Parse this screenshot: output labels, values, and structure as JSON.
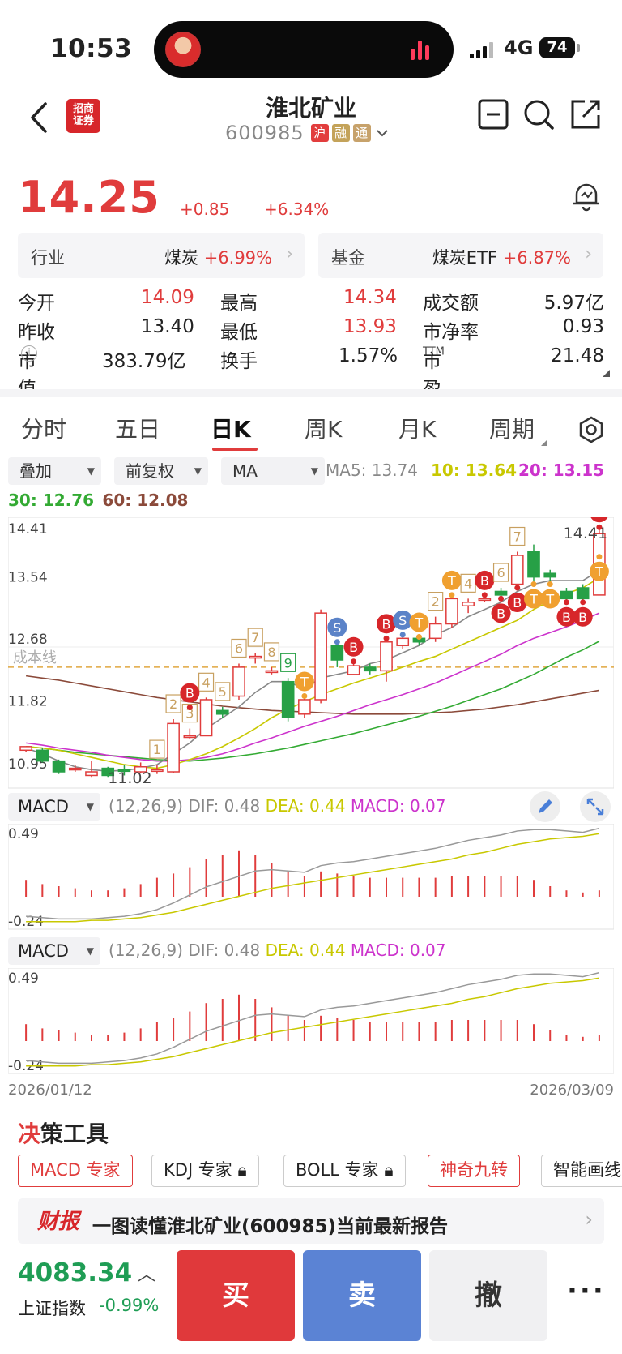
{
  "status_bar": {
    "time": "10:53",
    "network": "4G",
    "battery": "74"
  },
  "header": {
    "logo_text": "招商\n证券",
    "stock_name": "淮北矿业",
    "stock_code": "600985",
    "tags": [
      "沪",
      "融",
      "通"
    ]
  },
  "quote": {
    "price": "14.25",
    "change": "+0.85",
    "change_pct": "+6.34%"
  },
  "sector": {
    "industry_label": "行业",
    "industry_name": "煤炭",
    "industry_chg": "+6.99%",
    "fund_label": "基金",
    "fund_name": "煤炭ETF",
    "fund_chg": "+6.87%"
  },
  "stats": {
    "open_label": "今开",
    "open": "14.09",
    "high_label": "最高",
    "high": "14.34",
    "turnover_amt_label": "成交额",
    "turnover_amt": "5.97亿",
    "prev_close_label": "昨收",
    "prev_close": "13.40",
    "low_label": "最低",
    "low": "13.93",
    "pb_label": "市净率",
    "pb": "0.93",
    "mcap_label": "市值",
    "mcap": "383.79亿",
    "turnover_label": "换手",
    "turnover": "1.57%",
    "pe_label": "市盈",
    "pe_sup": "TTM",
    "pe": "21.48"
  },
  "tabs": [
    "分时",
    "五日",
    "日K",
    "周K",
    "月K",
    "周期"
  ],
  "active_tab": "日K",
  "controls": {
    "overlay": "叠加",
    "adjust": "前复权",
    "indicator": "MA",
    "ma5": "MA5: 13.74",
    "ma10": "10: 13.64",
    "ma20": "20: 13.15",
    "ma30": "30: 12.76",
    "ma60": "60: 12.08"
  },
  "colors": {
    "up": "#e03c3c",
    "down": "#27a046",
    "ma5": "#888888",
    "ma10": "#c8c800",
    "ma20": "#cc33cc",
    "ma30": "#33aa33",
    "ma60": "#8b4a3a",
    "cost_line": "#e0a840",
    "buy_marker": "#d7262a",
    "sell_marker": "#5b83c8",
    "t_marker": "#f0a030"
  },
  "chart_data": [
    {
      "type": "candlestick",
      "y_ticks": [
        "14.41",
        "13.54",
        "12.68",
        "11.82",
        "10.95"
      ],
      "ylim": [
        10.95,
        14.41
      ],
      "cost_line_label": "成本线",
      "cost_line_value": 12.4,
      "low_label": "11.02",
      "high_label": "14.41",
      "candles": [
        [
          11.25,
          11.3,
          11.3,
          11.22
        ],
        [
          11.25,
          11.1,
          11.28,
          11.08
        ],
        [
          11.1,
          10.95,
          11.12,
          10.92
        ],
        [
          11.0,
          11.0,
          11.05,
          10.95
        ],
        [
          10.9,
          10.95,
          11.1,
          10.88
        ],
        [
          11.0,
          10.9,
          11.02,
          10.88
        ],
        [
          10.98,
          10.97,
          11.05,
          10.9
        ],
        [
          10.95,
          11.02,
          11.08,
          10.93
        ],
        [
          10.98,
          10.98,
          11.05,
          10.92
        ],
        [
          10.95,
          11.62,
          11.68,
          10.93
        ],
        [
          11.45,
          11.45,
          11.55,
          11.4
        ],
        [
          11.45,
          11.95,
          11.98,
          11.45
        ],
        [
          11.8,
          11.75,
          11.85,
          11.7
        ],
        [
          12.0,
          12.4,
          12.45,
          11.95
        ],
        [
          12.55,
          12.55,
          12.6,
          12.45
        ],
        [
          12.35,
          12.35,
          12.4,
          12.3
        ],
        [
          12.2,
          11.7,
          12.25,
          11.65
        ],
        [
          11.75,
          11.95,
          12.0,
          11.7
        ],
        [
          11.95,
          13.15,
          13.2,
          11.9
        ],
        [
          12.7,
          12.5,
          12.75,
          12.4
        ],
        [
          12.3,
          12.42,
          12.48,
          12.3
        ],
        [
          12.4,
          12.35,
          12.45,
          12.3
        ],
        [
          12.35,
          12.75,
          12.8,
          12.2
        ],
        [
          12.7,
          12.8,
          12.85,
          12.65
        ],
        [
          12.8,
          12.75,
          12.82,
          12.7
        ],
        [
          12.8,
          13.0,
          13.1,
          12.75
        ],
        [
          13.0,
          13.35,
          13.4,
          12.95
        ],
        [
          13.25,
          13.3,
          13.35,
          13.15
        ],
        [
          13.35,
          13.35,
          13.4,
          13.3
        ],
        [
          13.45,
          13.4,
          13.5,
          13.35
        ],
        [
          13.55,
          13.95,
          14.0,
          13.5
        ],
        [
          14.0,
          13.65,
          14.1,
          13.55
        ],
        [
          13.7,
          13.65,
          13.75,
          13.55
        ],
        [
          13.45,
          13.35,
          13.5,
          13.3
        ],
        [
          13.5,
          13.35,
          13.55,
          13.3
        ],
        [
          13.4,
          14.25,
          14.34,
          13.93
        ]
      ],
      "ma5": [
        11.28,
        11.2,
        11.1,
        11.02,
        10.98,
        10.96,
        10.97,
        11.0,
        11.05,
        11.2,
        11.35,
        11.55,
        11.7,
        11.85,
        12.05,
        12.2,
        12.2,
        12.1,
        12.25,
        12.3,
        12.35,
        12.45,
        12.5,
        12.6,
        12.7,
        12.85,
        12.95,
        13.1,
        13.2,
        13.3,
        13.45,
        13.55,
        13.6,
        13.6,
        13.6,
        13.74
      ],
      "ma10": [
        11.3,
        11.28,
        11.25,
        11.2,
        11.15,
        11.1,
        11.05,
        11.02,
        11.0,
        11.05,
        11.12,
        11.2,
        11.3,
        11.42,
        11.55,
        11.7,
        11.82,
        11.92,
        12.02,
        12.1,
        12.18,
        12.25,
        12.32,
        12.4,
        12.48,
        12.55,
        12.65,
        12.75,
        12.85,
        12.95,
        13.05,
        13.2,
        13.32,
        13.42,
        13.5,
        13.64
      ],
      "ma20": [
        11.35,
        11.32,
        11.28,
        11.25,
        11.22,
        11.18,
        11.15,
        11.12,
        11.1,
        11.1,
        11.12,
        11.15,
        11.2,
        11.27,
        11.35,
        11.42,
        11.5,
        11.58,
        11.65,
        11.72,
        11.8,
        11.88,
        11.95,
        12.02,
        12.1,
        12.18,
        12.28,
        12.38,
        12.48,
        12.58,
        12.7,
        12.8,
        12.88,
        12.96,
        13.05,
        13.15
      ],
      "ma30": [
        11.3,
        11.28,
        11.25,
        11.22,
        11.2,
        11.18,
        11.16,
        11.14,
        11.12,
        11.11,
        11.1,
        11.12,
        11.14,
        11.17,
        11.2,
        11.24,
        11.28,
        11.33,
        11.38,
        11.43,
        11.48,
        11.54,
        11.6,
        11.66,
        11.72,
        11.79,
        11.86,
        11.94,
        12.02,
        12.1,
        12.2,
        12.3,
        12.42,
        12.54,
        12.64,
        12.76
      ],
      "ma60": [
        12.28,
        12.25,
        12.22,
        12.18,
        12.14,
        12.1,
        12.06,
        12.02,
        11.98,
        11.95,
        11.92,
        11.89,
        11.86,
        11.84,
        11.82,
        11.8,
        11.79,
        11.78,
        11.77,
        11.76,
        11.75,
        11.75,
        11.75,
        11.75,
        11.76,
        11.77,
        11.78,
        11.8,
        11.82,
        11.85,
        11.88,
        11.92,
        11.96,
        12.0,
        12.04,
        12.08
      ],
      "markers": [
        {
          "i": 8,
          "label": "1",
          "kind": "nine"
        },
        {
          "i": 9,
          "label": "2",
          "kind": "nine"
        },
        {
          "i": 10,
          "label": "3",
          "kind": "nine"
        },
        {
          "i": 11,
          "label": "4",
          "kind": "nine"
        },
        {
          "i": 12,
          "label": "5",
          "kind": "nine"
        },
        {
          "i": 13,
          "label": "6",
          "kind": "nine"
        },
        {
          "i": 14,
          "label": "7",
          "kind": "nine"
        },
        {
          "i": 15,
          "label": "8",
          "kind": "nine"
        },
        {
          "i": 16,
          "label": "9",
          "kind": "nine-green"
        },
        {
          "i": 10,
          "label": "B",
          "kind": "buy"
        },
        {
          "i": 17,
          "label": "T",
          "kind": "t"
        },
        {
          "i": 19,
          "label": "S",
          "kind": "sell"
        },
        {
          "i": 20,
          "label": "B",
          "kind": "buy"
        },
        {
          "i": 22,
          "label": "B",
          "kind": "buy"
        },
        {
          "i": 23,
          "label": "S",
          "kind": "sell"
        },
        {
          "i": 24,
          "label": "T",
          "kind": "t"
        },
        {
          "i": 25,
          "label": "2",
          "kind": "nine"
        },
        {
          "i": 26,
          "label": "T",
          "kind": "t"
        },
        {
          "i": 27,
          "label": "4",
          "kind": "nine"
        },
        {
          "i": 28,
          "label": "B",
          "kind": "buy"
        },
        {
          "i": 29,
          "label": "6",
          "kind": "nine"
        },
        {
          "i": 30,
          "label": "7",
          "kind": "nine"
        },
        {
          "i": 29,
          "label": "B",
          "kind": "buy-low"
        },
        {
          "i": 30,
          "label": "B",
          "kind": "buy-low"
        },
        {
          "i": 31,
          "label": "T",
          "kind": "t-low"
        },
        {
          "i": 32,
          "label": "T",
          "kind": "t-low"
        },
        {
          "i": 33,
          "label": "B",
          "kind": "buy-low"
        },
        {
          "i": 34,
          "label": "B",
          "kind": "buy-low"
        },
        {
          "i": 35,
          "label": "B",
          "kind": "buy"
        },
        {
          "i": 35,
          "label": "T",
          "kind": "t-low"
        }
      ]
    },
    {
      "type": "macd",
      "title": "MACD",
      "params": "(12,26,9)",
      "dif": "DIF: 0.48",
      "dea": "DEA: 0.44",
      "macd": "MACD: 0.07",
      "y_ticks": [
        "0.49",
        "-0.24"
      ],
      "ylim": [
        -0.24,
        0.49
      ],
      "hist": [
        0.08,
        0.06,
        0.05,
        0.04,
        0.03,
        0.03,
        0.04,
        0.06,
        0.09,
        0.11,
        0.14,
        0.18,
        0.2,
        0.22,
        0.2,
        0.16,
        0.12,
        0.1,
        0.12,
        0.11,
        0.1,
        0.09,
        0.09,
        0.09,
        0.09,
        0.09,
        0.1,
        0.1,
        0.1,
        0.1,
        0.1,
        0.08,
        0.05,
        0.03,
        0.02,
        0.03
      ],
      "dif_line": [
        -0.18,
        -0.19,
        -0.2,
        -0.2,
        -0.2,
        -0.19,
        -0.18,
        -0.16,
        -0.13,
        -0.08,
        -0.02,
        0.04,
        0.08,
        0.12,
        0.16,
        0.17,
        0.16,
        0.15,
        0.2,
        0.22,
        0.23,
        0.25,
        0.27,
        0.29,
        0.31,
        0.33,
        0.36,
        0.39,
        0.41,
        0.43,
        0.46,
        0.47,
        0.47,
        0.46,
        0.45,
        0.48
      ],
      "dea_line": [
        -0.22,
        -0.22,
        -0.22,
        -0.22,
        -0.21,
        -0.21,
        -0.2,
        -0.19,
        -0.17,
        -0.15,
        -0.12,
        -0.09,
        -0.06,
        -0.03,
        0.0,
        0.03,
        0.05,
        0.07,
        0.09,
        0.11,
        0.13,
        0.15,
        0.17,
        0.19,
        0.21,
        0.23,
        0.25,
        0.28,
        0.3,
        0.33,
        0.36,
        0.38,
        0.4,
        0.41,
        0.42,
        0.44
      ]
    }
  ],
  "date_range": {
    "start": "2026/01/12",
    "end": "2026/03/09"
  },
  "tools": {
    "title_first": "决",
    "title_rest": "策工具",
    "chips": [
      "MACD 专家",
      "KDJ 专家",
      "BOLL 专家",
      "神奇九转",
      "智能画线"
    ]
  },
  "report": {
    "logo": "财报",
    "text": "一图读懂淮北矿业(600985)当前最新报告"
  },
  "bottom": {
    "index_value": "4083.34",
    "index_name": "上证指数",
    "index_chg": "-0.99%",
    "buy": "买",
    "sell": "卖",
    "cancel": "撤"
  }
}
